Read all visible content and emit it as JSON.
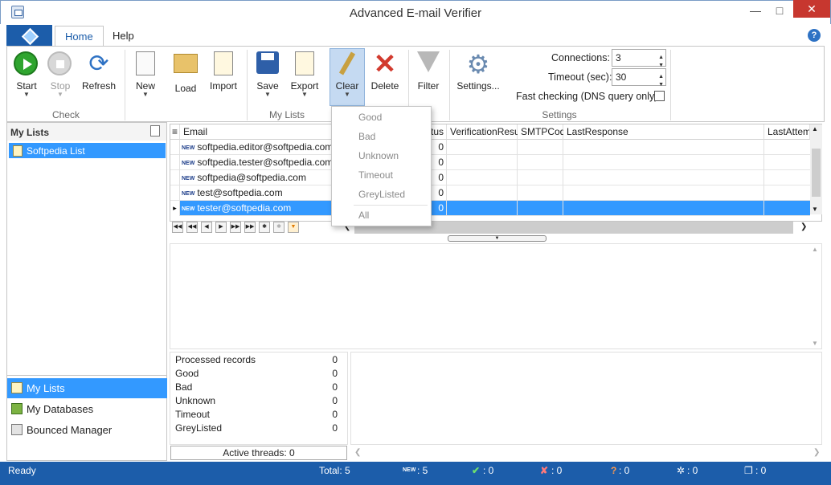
{
  "window": {
    "title": "Advanced E-mail Verifier"
  },
  "ribbon_tabs": [
    "Home",
    "Help"
  ],
  "ribbon": {
    "buttons": {
      "start": "Start",
      "stop": "Stop",
      "refresh": "Refresh",
      "new": "New",
      "load": "Load",
      "import": "Import",
      "save": "Save",
      "export": "Export",
      "clear": "Clear",
      "delete": "Delete",
      "filter": "Filter",
      "settings": "Settings..."
    },
    "groups": {
      "check": "Check",
      "mylists": "My Lists",
      "settings": "Settings"
    },
    "settings": {
      "connections_label": "Connections:",
      "connections_value": "3",
      "timeout_label": "Timeout (sec):",
      "timeout_value": "30",
      "fast_checking_label": "Fast checking (DNS query only)"
    }
  },
  "clear_menu": [
    "Good",
    "Bad",
    "Unknown",
    "Timeout",
    "GreyListed",
    "All"
  ],
  "left_panel": {
    "header": "My Lists",
    "lists": [
      "Softpedia List"
    ],
    "nav": [
      "My Lists",
      "My Databases",
      "Bounced Manager"
    ]
  },
  "grid": {
    "columns": [
      "Email",
      "tus",
      "VerificationResult",
      "SMTPCode",
      "LastResponse",
      "LastAttemp"
    ],
    "new_tag": "NEW",
    "rows": [
      {
        "email": "softpedia.editor@softpedia.com",
        "status": "0"
      },
      {
        "email": "softpedia.tester@softpedia.com",
        "status": "0"
      },
      {
        "email": "softpedia@softpedia.com",
        "status": "0"
      },
      {
        "email": "test@softpedia.com",
        "status": "0"
      },
      {
        "email": "tester@softpedia.com",
        "status": "0"
      }
    ]
  },
  "stats": {
    "rows": [
      {
        "label": "Processed records",
        "value": "0"
      },
      {
        "label": "Good",
        "value": "0"
      },
      {
        "label": "Bad",
        "value": "0"
      },
      {
        "label": "Unknown",
        "value": "0"
      },
      {
        "label": "Timeout",
        "value": "0"
      },
      {
        "label": "GreyListed",
        "value": "0"
      }
    ],
    "active_threads": "Active threads: 0"
  },
  "statusbar": {
    "ready": "Ready",
    "total": "Total: 5",
    "new": ": 5",
    "good": ": 0",
    "bad": ": 0",
    "unknown": ": 0",
    "timeout": ": 0",
    "greylisted": ": 0"
  },
  "colors": {
    "accent": "#1c5daa",
    "selection": "#3399ff",
    "close": "#c7372f"
  }
}
